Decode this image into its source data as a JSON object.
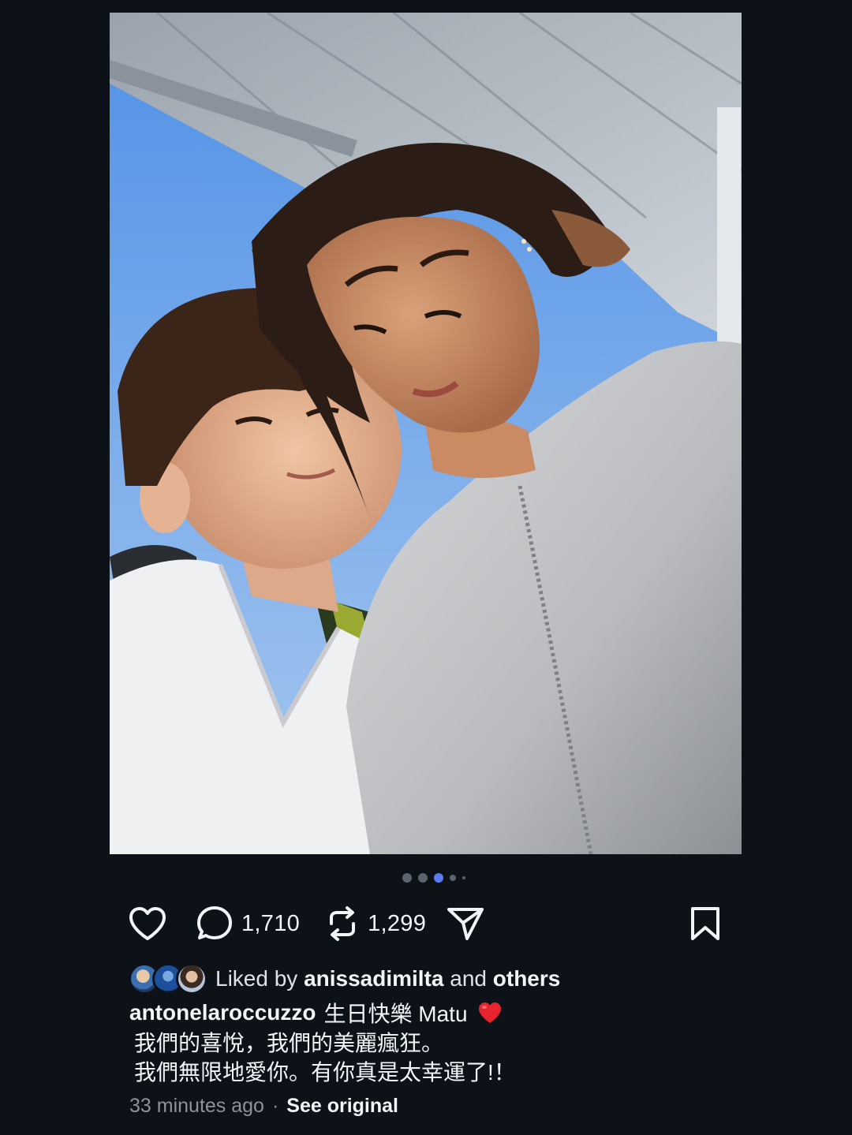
{
  "post": {
    "image_alt": "selfie photo",
    "carousel": {
      "count": 5,
      "active_index": 2
    },
    "actions": {
      "like_icon": "heart-outline-icon",
      "comment_icon": "comment-bubble-icon",
      "comment_count": "1,710",
      "repost_icon": "repost-arrows-icon",
      "repost_count": "1,299",
      "share_icon": "send-plane-icon",
      "bookmark_icon": "bookmark-icon"
    },
    "likes": {
      "prefix": "Liked by",
      "user": "anissadimilta",
      "conjunction": "and",
      "others": "others"
    },
    "caption": {
      "username": "antonelaroccuzzo",
      "line1": "生日快樂 Matu",
      "emoji": "red-heart-emoji",
      "line2": "我們的喜悅，我們的美麗瘋狂。",
      "line3": "我們無限地愛你。有你真是太幸運了!！"
    },
    "meta": {
      "time_ago": "33 minutes ago",
      "separator": "·",
      "see_original": "See original"
    }
  },
  "colors": {
    "background": "#0d1219",
    "text": "#f2f4f7",
    "muted": "#8c939c",
    "active_dot": "#5a7cf0",
    "heart_red": "#e8242f"
  }
}
